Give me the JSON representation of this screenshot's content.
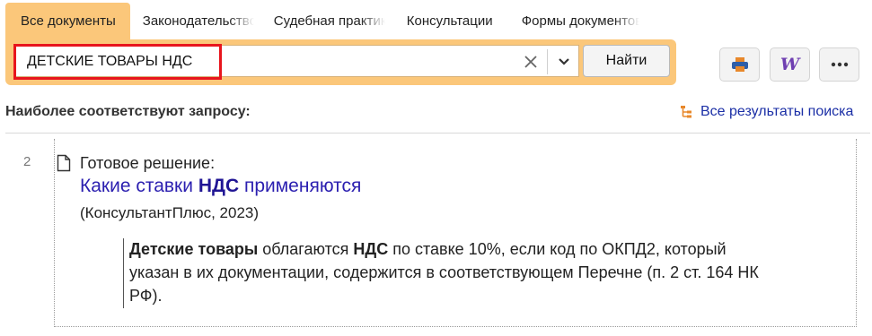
{
  "tabs": [
    {
      "label": "Все документы",
      "active": true
    },
    {
      "label": "Законодательство",
      "active": false
    },
    {
      "label": "Судебная практика",
      "active": false
    },
    {
      "label": "Консультации",
      "active": false
    },
    {
      "label": "Формы документов",
      "active": false
    }
  ],
  "search": {
    "query": "ДЕТСКИЕ ТОВАРЫ НДС",
    "find_label": "Найти",
    "clear_icon": "close-icon",
    "dropdown_icon": "chevron-down-icon"
  },
  "toolbar": {
    "print_icon": "printer-icon",
    "word_icon": "word-export-icon",
    "word_letter": "W",
    "more_icon": "more-dots-icon"
  },
  "results_header": {
    "heading": "Наиболее соответствуют запросу:",
    "all_results_label": "Все результаты поиска"
  },
  "result": {
    "number": "2",
    "kind": "Готовое решение:",
    "title_before": "Какие ставки ",
    "title_bold": "НДС",
    "title_after": " применяются",
    "source": "(КонсультантПлюс, 2023)",
    "snippet": {
      "b1": "Детские товары",
      "t1": " облагаются ",
      "b2": "НДС",
      "t2": " по ставке 10%, если код по ОКПД2, который указан в их документации, содержится в соответствующем Перечне (п. 2 ст. 164 НК РФ)."
    }
  },
  "colors": {
    "accent_orange": "#fbc77a",
    "highlight_red": "#e8151d",
    "link_blue": "#2b1fb0"
  }
}
